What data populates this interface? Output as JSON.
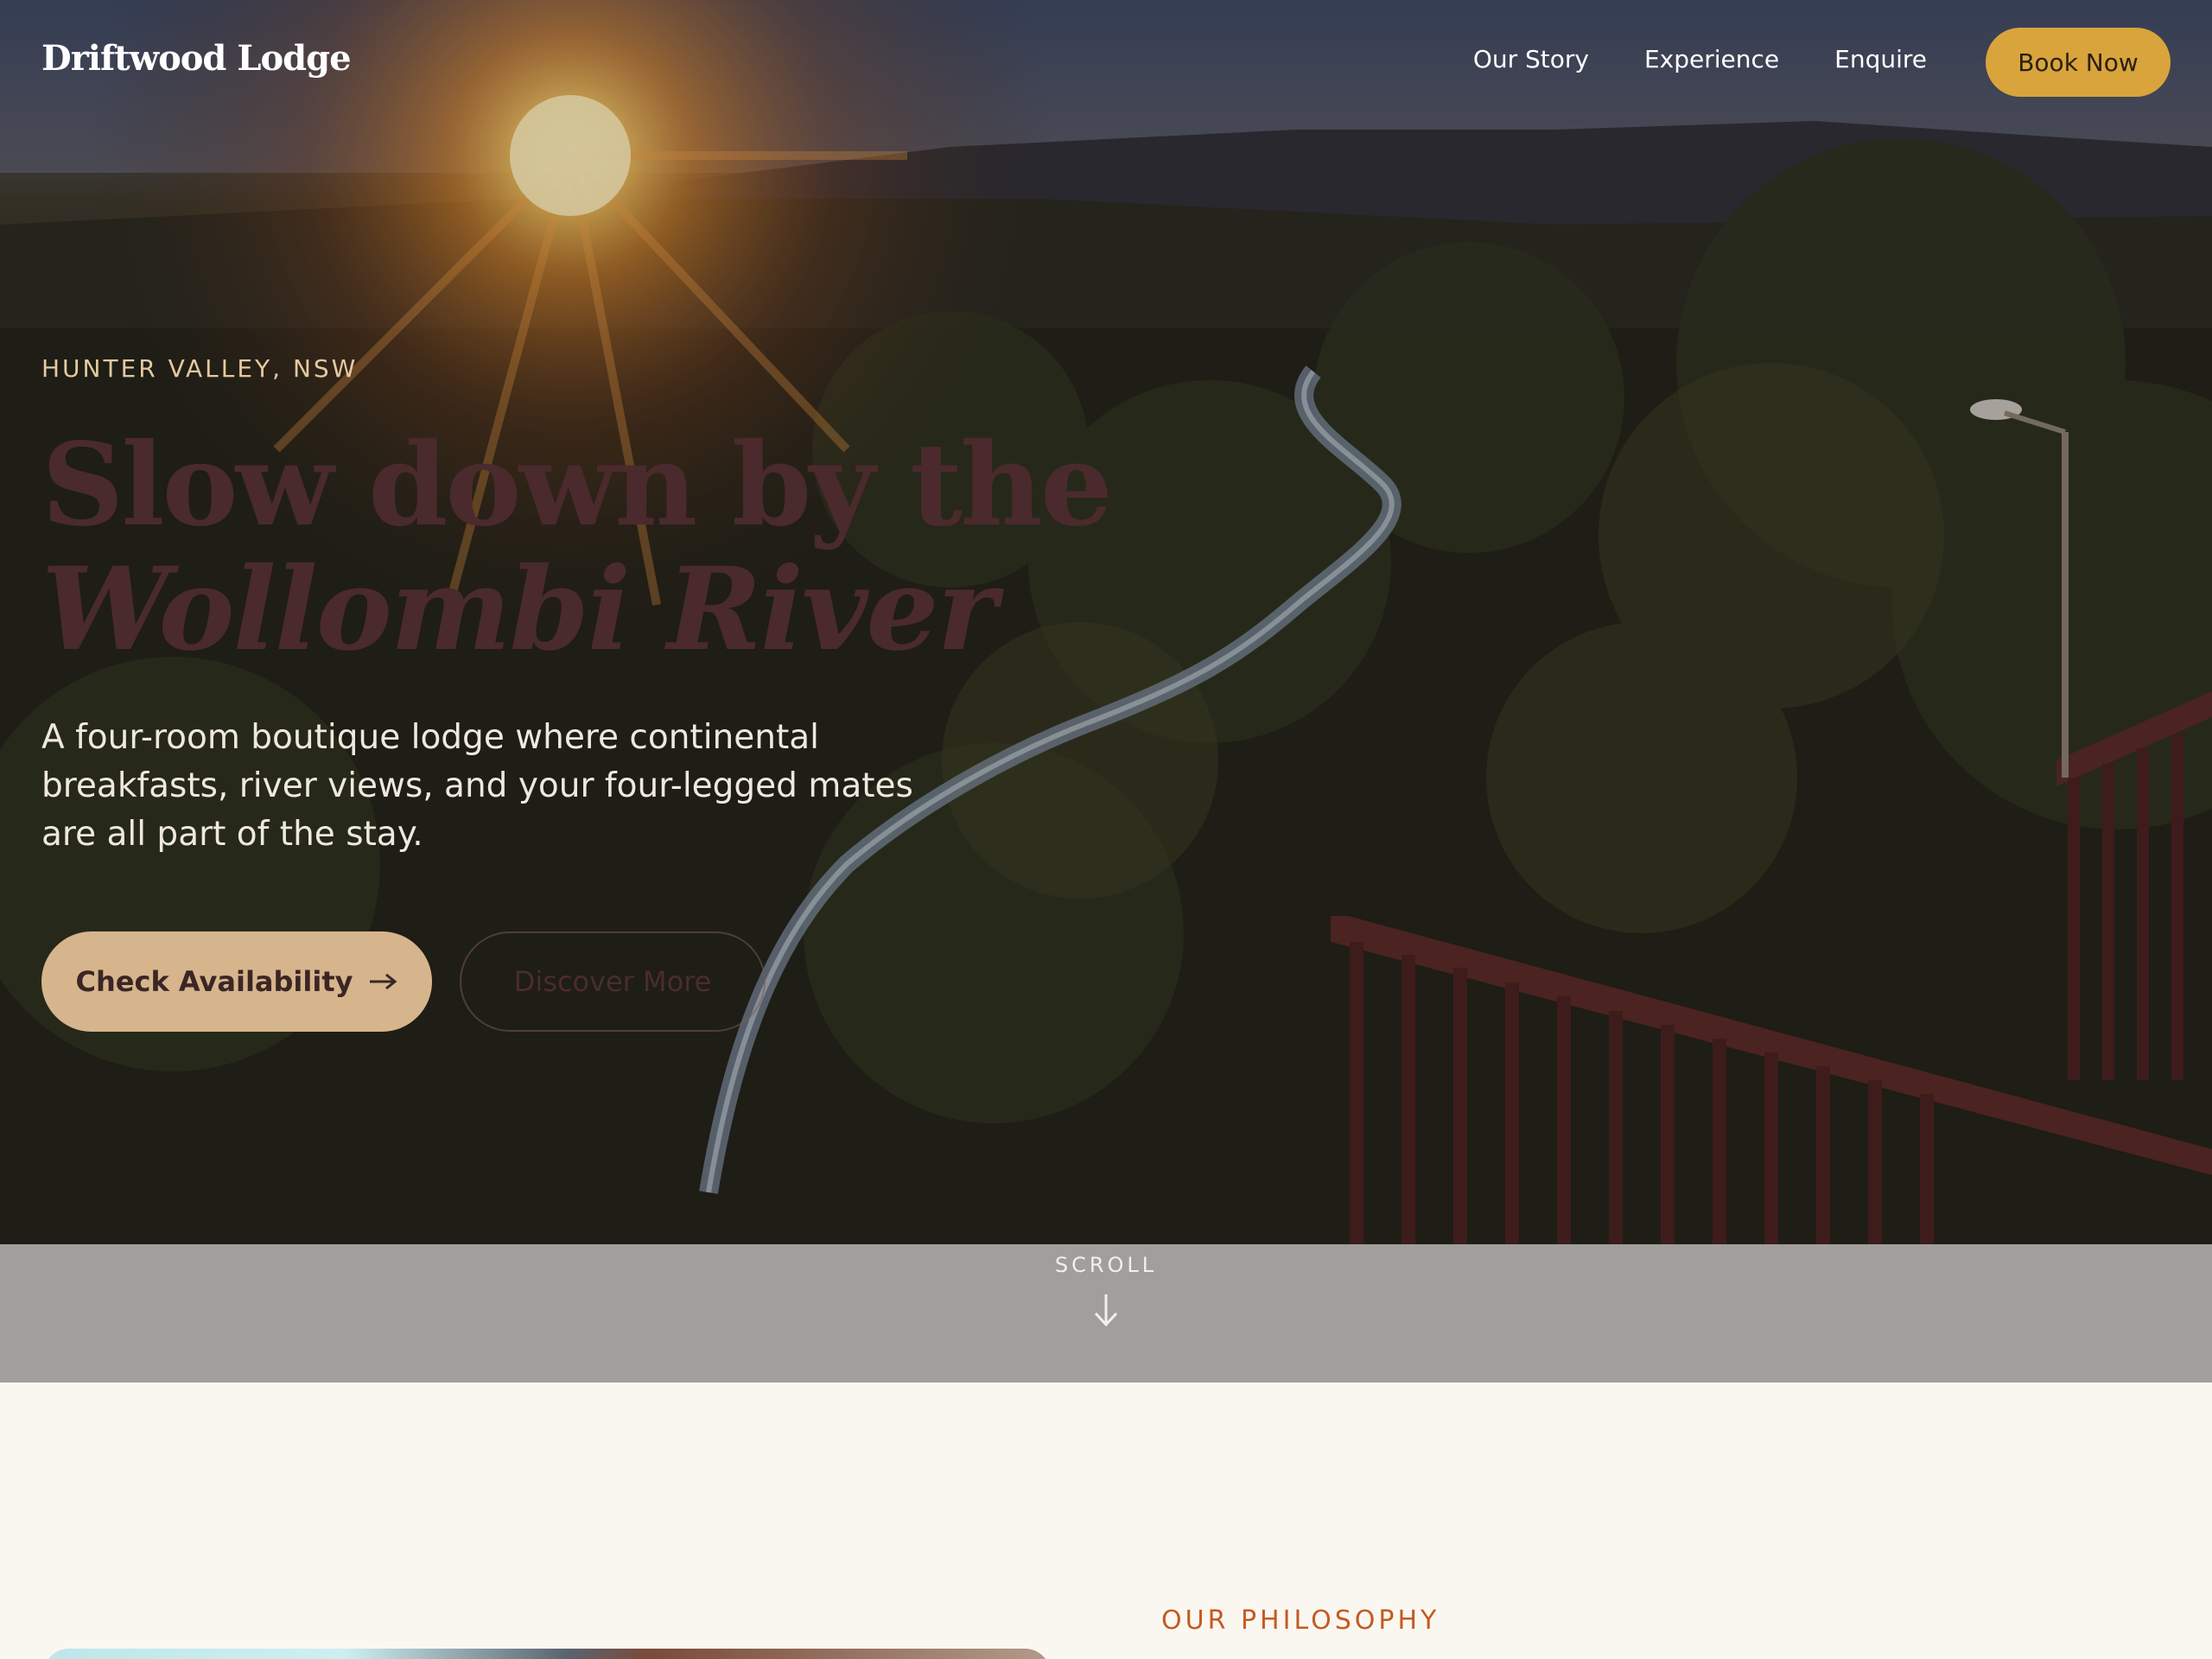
{
  "nav": {
    "logo": "Driftwood Lodge",
    "links": [
      "Our Story",
      "Experience",
      "Enquire"
    ],
    "book_label": "Book Now"
  },
  "hero": {
    "eyebrow": "HUNTER VALLEY, NSW",
    "headline_line1": "Slow down by the",
    "headline_line2": "Wollombi River",
    "description": "A four-room boutique lodge where continental breakfasts, river views, and your four-legged mates are all part of the stay.",
    "primary_cta": "Check Availability",
    "primary_cta_icon": "arrow-right-icon",
    "secondary_cta": "Discover More",
    "background_image": "sunset over river valley with eucalyptus trees and timber deck railing"
  },
  "scroll": {
    "label": "SCROLL",
    "icon": "arrow-down-icon"
  },
  "philosophy": {
    "eyebrow": "OUR PHILOSOPHY"
  },
  "colors": {
    "accent_gold": "#d9a43c",
    "cta_tan": "#d6b58d",
    "headline_maroon": "#4a2a2c",
    "eyebrow_orange": "#c55a22",
    "page_bg": "#faf7f1"
  }
}
